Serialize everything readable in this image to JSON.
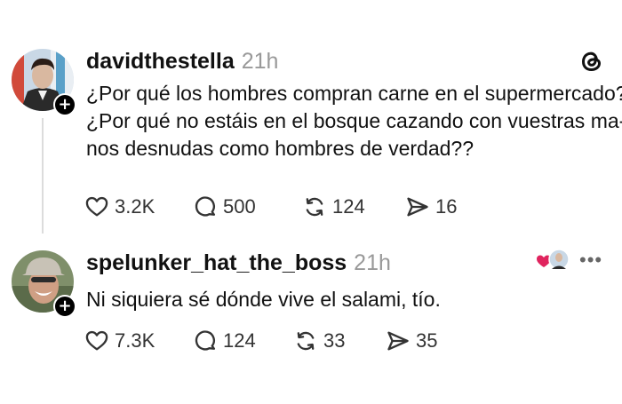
{
  "posts": [
    {
      "username": "davidthestella",
      "time": "21h",
      "lines": [
        "¿Por qué los hombres compran carne en el supermercado?",
        "¿Por qué no estáis en el bosque cazando con vuestras ma-",
        "nos desnudas como hombres de verdad??"
      ],
      "likes": "3.2K",
      "replies": "500",
      "reposts": "124",
      "shares": "16"
    },
    {
      "username": "spelunker_hat_the_boss",
      "time": "21h",
      "lines": [
        "Ni siquiera sé dónde vive el salami, tío."
      ],
      "likes": "7.3K",
      "replies": "124",
      "reposts": "33",
      "shares": "35"
    }
  ],
  "follow_symbol": "+",
  "more_symbol": "•••",
  "colors": {
    "heart_red": "#e0245e",
    "muted": "#999999",
    "icon": "#333333"
  }
}
